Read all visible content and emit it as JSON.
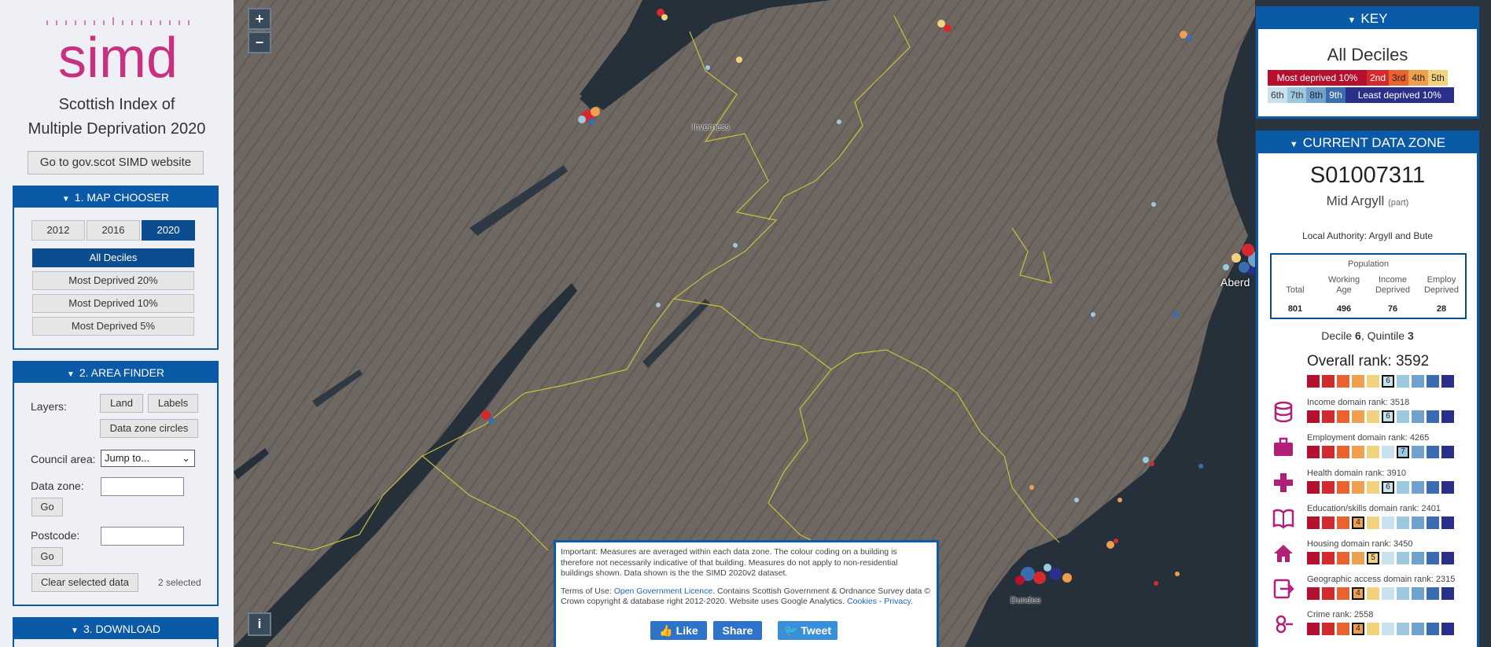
{
  "sidebar": {
    "logo_text": "simd",
    "title_line1": "Scottish Index of",
    "title_line2": "Multiple Deprivation 2020",
    "gov_button": "Go to gov.scot SIMD website"
  },
  "map_chooser": {
    "title": "1. MAP CHOOSER",
    "years": [
      "2012",
      "2016",
      "2020"
    ],
    "active_year": "2020",
    "options": [
      "All Deciles",
      "Most Deprived 20%",
      "Most Deprived 10%",
      "Most Deprived 5%"
    ],
    "active_option": "All Deciles"
  },
  "area_finder": {
    "title": "2. AREA FINDER",
    "layers_label": "Layers:",
    "land_button": "Land",
    "labels_button": "Labels",
    "circles_button": "Data zone circles",
    "council_label": "Council area:",
    "council_value": "Jump to...",
    "datazone_label": "Data zone:",
    "datazone_go": "Go",
    "postcode_label": "Postcode:",
    "postcode_go": "Go",
    "clear_button": "Clear selected data",
    "selected_count": "2 selected"
  },
  "download": {
    "title": "3. DOWNLOAD"
  },
  "map": {
    "zoom_in": "+",
    "zoom_out": "−",
    "info": "i",
    "places": [
      "Inverness",
      "Aberdeen",
      "Dundee"
    ],
    "place_aberdeen_visible": "Aberd"
  },
  "notice": {
    "line1": "Important: Measures are averaged within each data zone. The colour coding on a building is therefore not necessarily indicative of that building. Measures do not apply to non-residential buildings shown. Data shown is the the SIMD 2020v2 dataset.",
    "terms_prefix": "Terms of Use:",
    "licence_link": "Open Government Licence",
    "terms_suffix": ". Contains Scottish Government & Ordnance Survey data © Crown copyright & database right 2012-2020. Website uses Google Analytics.",
    "cookies_link": "Cookies - Privacy",
    "like": "Like",
    "share": "Share",
    "tweet": "Tweet"
  },
  "key": {
    "header": "KEY",
    "title": "All Deciles",
    "row1": [
      "Most deprived 10%",
      "2nd",
      "3rd",
      "4th",
      "5th"
    ],
    "row2": [
      "6th",
      "7th",
      "8th",
      "9th",
      "Least deprived 10%"
    ],
    "colors": [
      "#b5112e",
      "#d42a2f",
      "#e8632f",
      "#eea04f",
      "#f1d27e",
      "#c9e2ee",
      "#9ec8e0",
      "#6fa2cc",
      "#3b6cb0",
      "#2a2f8a"
    ]
  },
  "data_zone": {
    "header": "CURRENT DATA ZONE",
    "code": "S01007311",
    "name": "Mid Argyll",
    "name_suffix": "(part)",
    "local_authority": "Local Authority: Argyll and Bute",
    "population_title": "Population",
    "pop_cols": [
      {
        "label1": "",
        "label2": "Total",
        "value": "801"
      },
      {
        "label1": "Working",
        "label2": "Age",
        "value": "496"
      },
      {
        "label1": "Income",
        "label2": "Deprived",
        "value": "76"
      },
      {
        "label1": "Employ",
        "label2": "Deprived",
        "value": "28"
      }
    ],
    "decile_text": "Decile",
    "decile_value": "6",
    "quintile_text": ", Quintile",
    "quintile_value": "3",
    "overall_rank": "Overall rank: 3592",
    "overall_decile": 6,
    "domains": [
      {
        "label": "Income domain rank: 3518",
        "decile": 6,
        "icon": "database-icon"
      },
      {
        "label": "Employment domain rank: 4265",
        "decile": 7,
        "icon": "briefcase-icon"
      },
      {
        "label": "Health domain rank: 3910",
        "decile": 6,
        "icon": "health-cross-icon"
      },
      {
        "label": "Education/skills domain rank: 2401",
        "decile": 4,
        "icon": "book-icon"
      },
      {
        "label": "Housing domain rank: 3450",
        "decile": 5,
        "icon": "house-icon"
      },
      {
        "label": "Geographic access domain rank: 2315",
        "decile": 4,
        "icon": "access-exit-icon"
      },
      {
        "label": "Crime rank: 2558",
        "decile": 4,
        "icon": "crime-icon"
      }
    ]
  }
}
